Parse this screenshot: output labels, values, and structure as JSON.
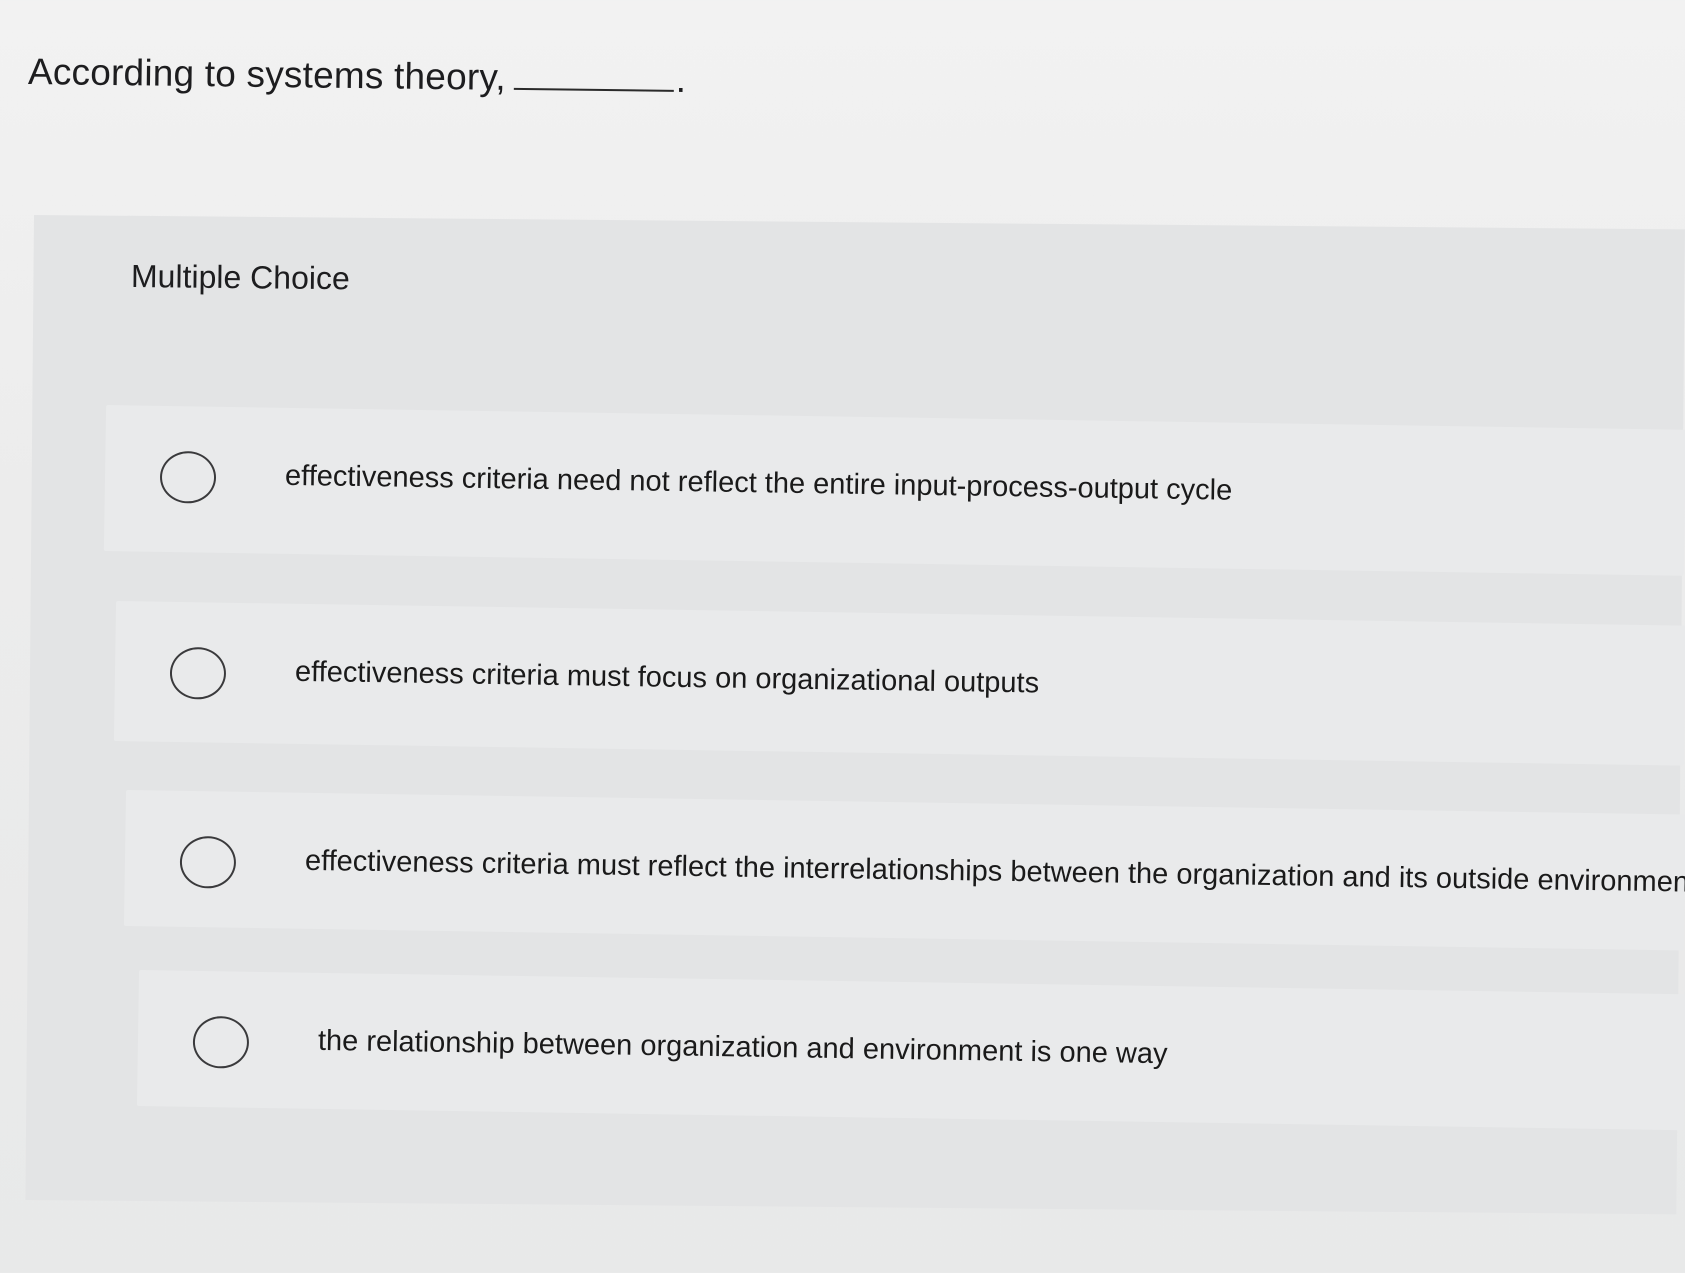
{
  "question": {
    "text": "According to systems theory,",
    "period": "."
  },
  "section_label": "Multiple Choice",
  "options": [
    {
      "label": "effectiveness criteria need not reflect the entire input-process-output cycle",
      "selected": false
    },
    {
      "label": "effectiveness criteria must focus on organizational outputs",
      "selected": false
    },
    {
      "label": "effectiveness criteria must reflect the interrelationships between the organization and its outside environment",
      "selected": false
    },
    {
      "label": "the relationship between organization and environment is one way",
      "selected": false
    }
  ]
}
